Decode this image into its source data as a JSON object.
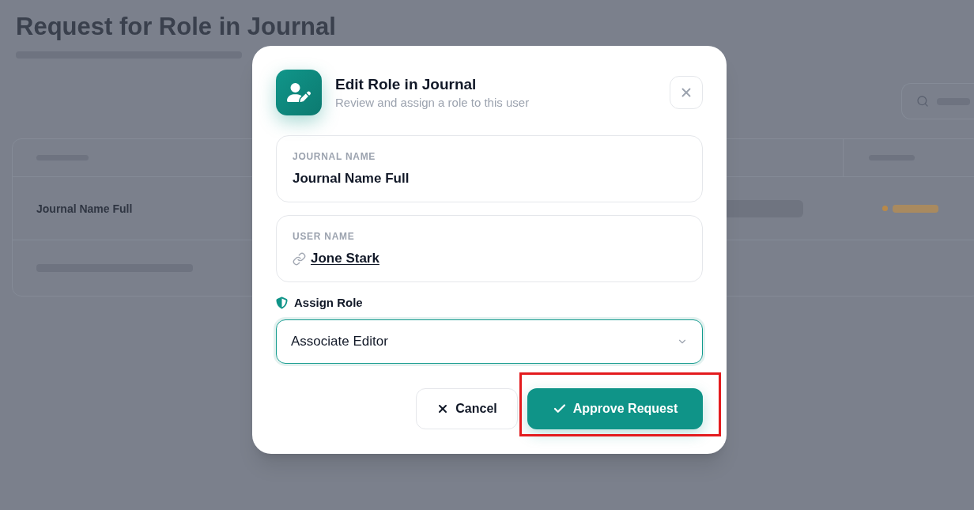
{
  "background_page": {
    "title": "Request for Role in Journal",
    "table": {
      "rows": [
        {
          "journal": "Journal Name Full"
        }
      ]
    }
  },
  "dialog": {
    "title": "Edit Role in Journal",
    "subtitle": "Review and assign a role to this user",
    "fields": [
      {
        "kind": "text",
        "label": "JOURNAL NAME",
        "value": "Journal Name Full"
      },
      {
        "kind": "link",
        "label": "USER NAME",
        "value": "Jone Stark"
      }
    ],
    "role": {
      "label": "Assign Role",
      "value": "Associate Editor"
    },
    "buttons": [
      {
        "kind": "secondary",
        "label": "Cancel",
        "highlighted": false
      },
      {
        "kind": "primary",
        "label": "Approve Request",
        "highlighted": true
      }
    ]
  }
}
